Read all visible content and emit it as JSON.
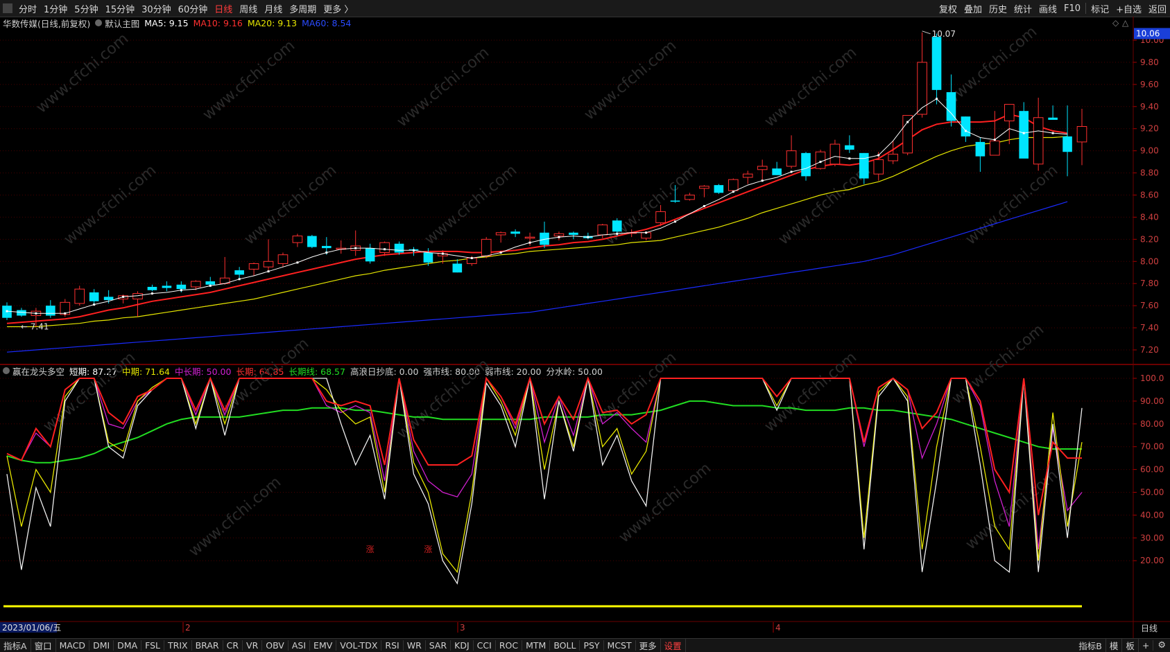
{
  "toolbar": {
    "periods": [
      "分时",
      "1分钟",
      "5分钟",
      "15分钟",
      "30分钟",
      "60分钟",
      "日线",
      "周线",
      "月线",
      "多周期",
      "更多 〉"
    ],
    "active_period": "日线",
    "actions": [
      "复权",
      "叠加",
      "历史",
      "统计",
      "画线",
      "F10",
      "标记",
      "+自选",
      "返回"
    ]
  },
  "main": {
    "stock": "华数传媒(日线,前复权)",
    "template": "默认主图",
    "ma5": "MA5: 9.15",
    "ma10": "MA10: 9.16",
    "ma20": "MA20: 9.13",
    "ma60": "MA60: 8.54",
    "current_price_tag": "10.06",
    "high_label": "10.07",
    "low_label": "7.41",
    "yaxis": [
      "10.00",
      "9.80",
      "9.60",
      "9.40",
      "9.20",
      "9.00",
      "8.80",
      "8.60",
      "8.40",
      "8.20",
      "8.00",
      "7.80",
      "7.60",
      "7.40",
      "7.20"
    ]
  },
  "indicator": {
    "name": "赢在龙头多空",
    "short": "短期: 87.27",
    "mid": "中期: 71.64",
    "midlong": "中长期: 50.00",
    "long": "长期: 64.85",
    "longline": "长期线: 68.57",
    "dip": "高浪日抄底: 0.00",
    "strong": "强市线: 80.00",
    "weak": "弱市线: 20.00",
    "divide": "分水岭: 50.00",
    "yaxis": [
      "100.0",
      "90.00",
      "80.00",
      "70.00",
      "60.00",
      "50.00",
      "40.00",
      "30.00",
      "20.00"
    ],
    "markers": [
      "涨",
      "涨"
    ]
  },
  "xaxis": {
    "date": "2023/01/06/五",
    "months": [
      "2",
      "3",
      "4"
    ],
    "right_label": "日线"
  },
  "bottom_tabs": [
    "指标A",
    "窗口",
    "MACD",
    "DMI",
    "DMA",
    "FSL",
    "TRIX",
    "BRAR",
    "CR",
    "VR",
    "OBV",
    "ASI",
    "EMV",
    "VOL-TDX",
    "RSI",
    "WR",
    "SAR",
    "KDJ",
    "CCI",
    "ROC",
    "MTM",
    "BOLL",
    "PSY",
    "MCST",
    "更多",
    "设置"
  ],
  "bottom_right": [
    "指标B",
    "模",
    "板",
    "+"
  ],
  "watermark": "www.cfchi.com",
  "colors": {
    "up": "#ff3030",
    "down": "#00e5ff",
    "ma5": "#ffffff",
    "ma10": "#ff2020",
    "ma20": "#e6e600",
    "ma60": "#1a2bff",
    "longline": "#22dd22"
  },
  "chart_data": {
    "type": "candlestick",
    "ylim_main": [
      7.15,
      10.15
    ],
    "ylim_sub": [
      0,
      100
    ],
    "candles": [
      {
        "o": 7.6,
        "h": 7.63,
        "l": 7.47,
        "c": 7.49
      },
      {
        "o": 7.56,
        "h": 7.58,
        "l": 7.5,
        "c": 7.51
      },
      {
        "o": 7.51,
        "h": 7.58,
        "l": 7.41,
        "c": 7.55
      },
      {
        "o": 7.6,
        "h": 7.65,
        "l": 7.49,
        "c": 7.51
      },
      {
        "o": 7.52,
        "h": 7.66,
        "l": 7.5,
        "c": 7.63
      },
      {
        "o": 7.62,
        "h": 7.78,
        "l": 7.6,
        "c": 7.75
      },
      {
        "o": 7.72,
        "h": 7.75,
        "l": 7.62,
        "c": 7.64
      },
      {
        "o": 7.68,
        "h": 7.74,
        "l": 7.62,
        "c": 7.65
      },
      {
        "o": 7.66,
        "h": 7.7,
        "l": 7.62,
        "c": 7.69
      },
      {
        "o": 7.66,
        "h": 7.73,
        "l": 7.5,
        "c": 7.71
      },
      {
        "o": 7.77,
        "h": 7.79,
        "l": 7.73,
        "c": 7.74
      },
      {
        "o": 7.78,
        "h": 7.82,
        "l": 7.73,
        "c": 7.76
      },
      {
        "o": 7.79,
        "h": 7.82,
        "l": 7.72,
        "c": 7.75
      },
      {
        "o": 7.77,
        "h": 7.83,
        "l": 7.74,
        "c": 7.82
      },
      {
        "o": 7.82,
        "h": 7.86,
        "l": 7.78,
        "c": 7.79
      },
      {
        "o": 7.8,
        "h": 8.04,
        "l": 7.79,
        "c": 7.85
      },
      {
        "o": 7.92,
        "h": 7.95,
        "l": 7.85,
        "c": 7.88
      },
      {
        "o": 7.93,
        "h": 7.99,
        "l": 7.87,
        "c": 7.98
      },
      {
        "o": 7.95,
        "h": 8.2,
        "l": 7.92,
        "c": 8.0
      },
      {
        "o": 7.98,
        "h": 8.08,
        "l": 7.95,
        "c": 8.06
      },
      {
        "o": 8.17,
        "h": 8.25,
        "l": 8.13,
        "c": 8.23
      },
      {
        "o": 8.23,
        "h": 8.24,
        "l": 8.12,
        "c": 8.13
      },
      {
        "o": 8.14,
        "h": 8.22,
        "l": 8.06,
        "c": 8.12
      },
      {
        "o": 8.11,
        "h": 8.19,
        "l": 8.07,
        "c": 8.12
      },
      {
        "o": 8.1,
        "h": 8.28,
        "l": 8.05,
        "c": 8.14
      },
      {
        "o": 8.12,
        "h": 8.16,
        "l": 7.98,
        "c": 8.0
      },
      {
        "o": 8.08,
        "h": 8.18,
        "l": 8.05,
        "c": 8.17
      },
      {
        "o": 8.16,
        "h": 8.18,
        "l": 8.06,
        "c": 8.08
      },
      {
        "o": 8.11,
        "h": 8.13,
        "l": 8.05,
        "c": 8.1
      },
      {
        "o": 8.08,
        "h": 8.12,
        "l": 7.96,
        "c": 7.99
      },
      {
        "o": 8.05,
        "h": 8.1,
        "l": 7.98,
        "c": 8.07
      },
      {
        "o": 7.98,
        "h": 8.02,
        "l": 7.9,
        "c": 7.9
      },
      {
        "o": 7.98,
        "h": 8.05,
        "l": 7.96,
        "c": 8.03
      },
      {
        "o": 8.05,
        "h": 8.22,
        "l": 8.03,
        "c": 8.2
      },
      {
        "o": 8.24,
        "h": 8.27,
        "l": 8.17,
        "c": 8.26
      },
      {
        "o": 8.27,
        "h": 8.29,
        "l": 8.22,
        "c": 8.25
      },
      {
        "o": 8.21,
        "h": 8.26,
        "l": 8.14,
        "c": 8.22
      },
      {
        "o": 8.26,
        "h": 8.36,
        "l": 8.12,
        "c": 8.15
      },
      {
        "o": 8.23,
        "h": 8.27,
        "l": 8.19,
        "c": 8.25
      },
      {
        "o": 8.26,
        "h": 8.27,
        "l": 8.2,
        "c": 8.24
      },
      {
        "o": 8.23,
        "h": 8.26,
        "l": 8.2,
        "c": 8.21
      },
      {
        "o": 8.24,
        "h": 8.34,
        "l": 8.21,
        "c": 8.33
      },
      {
        "o": 8.37,
        "h": 8.39,
        "l": 8.23,
        "c": 8.27
      },
      {
        "o": 8.26,
        "h": 8.29,
        "l": 8.22,
        "c": 8.26
      },
      {
        "o": 8.21,
        "h": 8.27,
        "l": 8.19,
        "c": 8.26
      },
      {
        "o": 8.35,
        "h": 8.51,
        "l": 8.32,
        "c": 8.45
      },
      {
        "o": 8.55,
        "h": 8.69,
        "l": 8.53,
        "c": 8.54
      },
      {
        "o": 8.56,
        "h": 8.62,
        "l": 8.55,
        "c": 8.6
      },
      {
        "o": 8.66,
        "h": 8.69,
        "l": 8.58,
        "c": 8.68
      },
      {
        "o": 8.69,
        "h": 8.7,
        "l": 8.61,
        "c": 8.62
      },
      {
        "o": 8.64,
        "h": 8.75,
        "l": 8.63,
        "c": 8.74
      },
      {
        "o": 8.76,
        "h": 8.82,
        "l": 8.7,
        "c": 8.79
      },
      {
        "o": 8.83,
        "h": 8.92,
        "l": 8.74,
        "c": 8.86
      },
      {
        "o": 8.84,
        "h": 8.9,
        "l": 8.78,
        "c": 8.78
      },
      {
        "o": 8.86,
        "h": 9.14,
        "l": 8.84,
        "c": 9.0
      },
      {
        "o": 8.98,
        "h": 8.99,
        "l": 8.73,
        "c": 8.77
      },
      {
        "o": 8.84,
        "h": 9.01,
        "l": 8.83,
        "c": 8.99
      },
      {
        "o": 8.88,
        "h": 9.1,
        "l": 8.86,
        "c": 9.06
      },
      {
        "o": 9.05,
        "h": 9.14,
        "l": 8.98,
        "c": 9.01
      },
      {
        "o": 8.98,
        "h": 8.98,
        "l": 8.7,
        "c": 8.75
      },
      {
        "o": 8.79,
        "h": 8.99,
        "l": 8.73,
        "c": 8.92
      },
      {
        "o": 8.91,
        "h": 9.09,
        "l": 8.88,
        "c": 8.97
      },
      {
        "o": 8.98,
        "h": 9.32,
        "l": 8.96,
        "c": 9.32
      },
      {
        "o": 9.33,
        "h": 10.07,
        "l": 9.3,
        "c": 9.8
      },
      {
        "o": 10.03,
        "h": 10.06,
        "l": 9.42,
        "c": 9.55
      },
      {
        "o": 9.53,
        "h": 9.69,
        "l": 9.22,
        "c": 9.27
      },
      {
        "o": 9.31,
        "h": 9.31,
        "l": 9.08,
        "c": 9.13
      },
      {
        "o": 9.08,
        "h": 9.12,
        "l": 8.81,
        "c": 8.95
      },
      {
        "o": 8.96,
        "h": 9.36,
        "l": 8.96,
        "c": 9.09
      },
      {
        "o": 9.27,
        "h": 9.42,
        "l": 9.06,
        "c": 9.42
      },
      {
        "o": 9.36,
        "h": 9.44,
        "l": 8.94,
        "c": 8.93
      },
      {
        "o": 8.88,
        "h": 9.48,
        "l": 8.82,
        "c": 9.3
      },
      {
        "o": 9.3,
        "h": 9.41,
        "l": 9.28,
        "c": 9.28
      },
      {
        "o": 9.13,
        "h": 9.41,
        "l": 8.77,
        "c": 8.99
      },
      {
        "o": 9.08,
        "h": 9.38,
        "l": 8.87,
        "c": 9.22
      }
    ],
    "ma5": [
      7.55,
      7.54,
      7.53,
      7.53,
      7.53,
      7.57,
      7.61,
      7.64,
      7.68,
      7.69,
      7.71,
      7.72,
      7.74,
      7.75,
      7.78,
      7.8,
      7.84,
      7.87,
      7.91,
      7.95,
      7.99,
      8.04,
      8.08,
      8.11,
      8.12,
      8.12,
      8.11,
      8.1,
      8.1,
      8.08,
      8.07,
      8.05,
      8.03,
      8.05,
      8.08,
      8.13,
      8.17,
      8.2,
      8.22,
      8.23,
      8.22,
      8.24,
      8.25,
      8.26,
      8.26,
      8.3,
      8.36,
      8.43,
      8.5,
      8.56,
      8.63,
      8.69,
      8.73,
      8.76,
      8.81,
      8.84,
      8.9,
      8.95,
      8.93,
      8.93,
      8.96,
      9.09,
      9.26,
      9.39,
      9.47,
      9.34,
      9.18,
      9.12,
      9.1,
      9.2,
      9.16,
      9.18,
      9.16,
      9.15
    ],
    "ma10": [
      7.44,
      7.45,
      7.46,
      7.47,
      7.48,
      7.5,
      7.53,
      7.56,
      7.58,
      7.61,
      7.64,
      7.66,
      7.68,
      7.7,
      7.72,
      7.75,
      7.78,
      7.81,
      7.84,
      7.87,
      7.9,
      7.93,
      7.96,
      7.99,
      8.02,
      8.04,
      8.06,
      8.07,
      8.08,
      8.09,
      8.09,
      8.09,
      8.08,
      8.08,
      8.09,
      8.1,
      8.12,
      8.14,
      8.15,
      8.17,
      8.18,
      8.2,
      8.23,
      8.26,
      8.29,
      8.33,
      8.38,
      8.43,
      8.48,
      8.53,
      8.58,
      8.63,
      8.68,
      8.73,
      8.78,
      8.83,
      8.86,
      8.88,
      8.87,
      8.89,
      8.93,
      9.01,
      9.1,
      9.19,
      9.24,
      9.26,
      9.26,
      9.26,
      9.27,
      9.33,
      9.3,
      9.22,
      9.18,
      9.16
    ],
    "ma20": [
      7.41,
      7.41,
      7.41,
      7.42,
      7.43,
      7.44,
      7.46,
      7.47,
      7.49,
      7.5,
      7.52,
      7.54,
      7.56,
      7.58,
      7.6,
      7.62,
      7.64,
      7.66,
      7.69,
      7.72,
      7.75,
      7.78,
      7.81,
      7.84,
      7.87,
      7.89,
      7.92,
      7.94,
      7.96,
      7.98,
      8.0,
      8.01,
      8.03,
      8.04,
      8.06,
      8.07,
      8.09,
      8.1,
      8.11,
      8.12,
      8.13,
      8.14,
      8.15,
      8.17,
      8.18,
      8.19,
      8.22,
      8.25,
      8.28,
      8.31,
      8.35,
      8.39,
      8.44,
      8.48,
      8.52,
      8.56,
      8.6,
      8.63,
      8.65,
      8.69,
      8.72,
      8.77,
      8.83,
      8.89,
      8.95,
      9.0,
      9.04,
      9.06,
      9.07,
      9.1,
      9.12,
      9.12,
      9.12,
      9.13
    ],
    "ma60": [
      7.18,
      7.19,
      7.2,
      7.21,
      7.22,
      7.23,
      7.24,
      7.25,
      7.26,
      7.27,
      7.28,
      7.29,
      7.3,
      7.31,
      7.32,
      7.33,
      7.34,
      7.35,
      7.36,
      7.37,
      7.38,
      7.39,
      7.4,
      7.41,
      7.42,
      7.43,
      7.44,
      7.45,
      7.46,
      7.47,
      7.48,
      7.49,
      7.5,
      7.51,
      7.52,
      7.53,
      7.54,
      7.56,
      7.58,
      7.6,
      7.62,
      7.64,
      7.66,
      7.68,
      7.7,
      7.72,
      7.74,
      7.76,
      7.78,
      7.8,
      7.82,
      7.84,
      7.86,
      7.88,
      7.9,
      7.92,
      7.94,
      7.96,
      7.98,
      8.0,
      8.03,
      8.06,
      8.1,
      8.14,
      8.18,
      8.22,
      8.26,
      8.3,
      8.34,
      8.38,
      8.42,
      8.46,
      8.5,
      8.54
    ],
    "short": [
      58,
      16,
      52,
      35,
      90,
      100,
      100,
      70,
      65,
      88,
      95,
      100,
      100,
      78,
      100,
      75,
      100,
      100,
      100,
      100,
      100,
      100,
      100,
      80,
      62,
      75,
      47,
      100,
      58,
      45,
      20,
      10,
      45,
      98,
      88,
      70,
      100,
      47,
      90,
      68,
      100,
      62,
      75,
      55,
      44,
      100,
      100,
      100,
      100,
      100,
      100,
      100,
      100,
      86,
      100,
      100,
      100,
      100,
      100,
      25,
      92,
      100,
      90,
      15,
      55,
      100,
      100,
      62,
      20,
      15,
      100,
      15,
      80,
      30,
      87
    ],
    "mid": [
      66,
      35,
      60,
      50,
      92,
      100,
      100,
      72,
      68,
      90,
      96,
      100,
      100,
      80,
      100,
      80,
      100,
      100,
      100,
      100,
      100,
      100,
      95,
      86,
      80,
      83,
      50,
      100,
      63,
      50,
      23,
      15,
      50,
      100,
      90,
      75,
      100,
      60,
      90,
      70,
      100,
      70,
      78,
      58,
      68,
      100,
      100,
      100,
      100,
      100,
      100,
      100,
      100,
      88,
      100,
      100,
      100,
      100,
      100,
      30,
      94,
      100,
      92,
      25,
      70,
      100,
      100,
      70,
      35,
      25,
      100,
      20,
      85,
      35,
      72
    ],
    "midlong": [
      67,
      64,
      76,
      70,
      95,
      100,
      100,
      80,
      78,
      90,
      95,
      100,
      100,
      84,
      100,
      84,
      100,
      100,
      100,
      100,
      100,
      100,
      88,
      85,
      88,
      85,
      55,
      100,
      68,
      55,
      50,
      48,
      58,
      100,
      92,
      78,
      100,
      72,
      92,
      75,
      100,
      80,
      85,
      78,
      72,
      100,
      100,
      100,
      100,
      100,
      100,
      100,
      100,
      92,
      100,
      100,
      100,
      100,
      100,
      70,
      96,
      100,
      95,
      65,
      80,
      100,
      100,
      88,
      55,
      35,
      100,
      25,
      78,
      42,
      50
    ],
    "long": [
      67,
      64,
      78,
      70,
      95,
      100,
      100,
      85,
      80,
      92,
      95,
      100,
      100,
      86,
      100,
      86,
      100,
      100,
      100,
      100,
      100,
      100,
      90,
      88,
      90,
      88,
      62,
      100,
      73,
      62,
      62,
      62,
      66,
      100,
      92,
      80,
      100,
      80,
      92,
      82,
      100,
      85,
      86,
      80,
      84,
      100,
      100,
      100,
      100,
      100,
      100,
      100,
      100,
      92,
      100,
      100,
      100,
      100,
      100,
      72,
      96,
      100,
      95,
      78,
      85,
      100,
      100,
      90,
      60,
      50,
      100,
      40,
      72,
      65,
      65
    ],
    "longline": [
      66,
      64,
      63,
      63,
      64,
      65,
      67,
      70,
      72,
      74,
      77,
      80,
      82,
      83,
      83,
      83,
      83,
      84,
      85,
      86,
      86,
      87,
      87,
      87,
      86,
      86,
      85,
      84,
      83,
      83,
      82,
      82,
      82,
      82,
      82,
      82,
      82,
      83,
      83,
      83,
      83,
      84,
      84,
      84,
      85,
      86,
      88,
      90,
      90,
      89,
      88,
      88,
      88,
      87,
      87,
      86,
      86,
      86,
      87,
      87,
      86,
      86,
      85,
      84,
      83,
      82,
      80,
      78,
      76,
      74,
      72,
      70,
      69,
      69,
      69
    ]
  }
}
